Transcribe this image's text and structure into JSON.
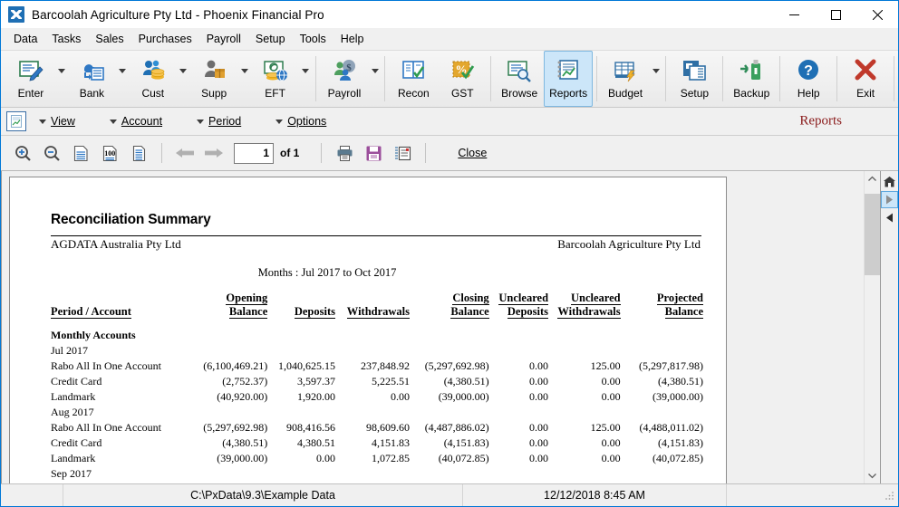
{
  "titlebar": {
    "title": "Barcoolah Agriculture Pty Ltd - Phoenix Financial Pro",
    "app_icon": "phoenix-app-icon",
    "minimize": "minimize-icon",
    "maximize": "maximize-icon",
    "close": "close-icon"
  },
  "menubar": {
    "items": [
      {
        "label": "Data"
      },
      {
        "label": "Tasks"
      },
      {
        "label": "Sales"
      },
      {
        "label": "Purchases"
      },
      {
        "label": "Payroll"
      },
      {
        "label": "Setup"
      },
      {
        "label": "Tools"
      },
      {
        "label": "Help"
      }
    ]
  },
  "ribbon": {
    "buttons": [
      {
        "label": "Enter",
        "icon": "enter-note-pencil-icon",
        "dropdown": true,
        "active": false
      },
      {
        "label": "Bank",
        "icon": "bank-cloud-icon",
        "dropdown": true,
        "active": false
      },
      {
        "label": "Cust",
        "icon": "customers-coins-icon",
        "dropdown": true,
        "active": false
      },
      {
        "label": "Supp",
        "icon": "supplier-box-icon",
        "dropdown": true,
        "active": false
      },
      {
        "label": "EFT",
        "icon": "eft-globe-coins-icon",
        "dropdown": true,
        "active": false
      },
      {
        "label": "Payroll",
        "icon": "payroll-dollar-icon",
        "dropdown": true,
        "active": false
      },
      {
        "label": "Recon",
        "icon": "recon-book-check-icon",
        "dropdown": false,
        "active": false
      },
      {
        "label": "GST",
        "icon": "gst-percent-check-icon",
        "dropdown": false,
        "active": false
      },
      {
        "label": "Browse",
        "icon": "browse-magnifier-icon",
        "dropdown": false,
        "active": false
      },
      {
        "label": "Reports",
        "icon": "reports-chart-icon",
        "dropdown": false,
        "active": true
      },
      {
        "label": "Budget",
        "icon": "budget-grid-bolt-icon",
        "dropdown": true,
        "active": false
      },
      {
        "label": "Setup",
        "icon": "setup-books-icon",
        "dropdown": false,
        "active": false
      },
      {
        "label": "Backup",
        "icon": "backup-usb-icon",
        "dropdown": false,
        "active": false
      },
      {
        "label": "Help",
        "icon": "help-question-icon",
        "dropdown": false,
        "active": false
      },
      {
        "label": "Exit",
        "icon": "exit-cross-icon",
        "dropdown": false,
        "active": false
      }
    ]
  },
  "viewbar": {
    "icon": "report-view-icon",
    "menus": [
      {
        "label": "View",
        "accel": "V"
      },
      {
        "label": "Account",
        "accel": "A"
      },
      {
        "label": "Period",
        "accel": "P"
      },
      {
        "label": "Options",
        "accel": "O"
      }
    ],
    "title": "Reports",
    "title_color": "#8a1a1a"
  },
  "report_toolbar": {
    "zoom_in": "zoom-in-icon",
    "zoom_out": "zoom-out-icon",
    "fit_width": "fit-width-icon",
    "zoom_100": "zoom-100-icon",
    "fit_page": "fit-page-icon",
    "prev_page": "prev-page-arrow-icon",
    "next_page": "next-page-arrow-icon",
    "page_value": "1",
    "page_of": "of 1",
    "print": "print-icon",
    "save": "save-floppy-icon",
    "export": "export-icon",
    "close_label": "Close",
    "close_accel": "C"
  },
  "report": {
    "title": "Reconciliation Summary",
    "subtitle_left": "AGDATA Australia Pty Ltd",
    "subtitle_right": "Barcoolah Agriculture Pty Ltd",
    "months": "Months : Jul 2017 to Oct 2017",
    "columns": [
      {
        "line1": "",
        "line2": "Period / Account",
        "align": "left"
      },
      {
        "line1": "Opening",
        "line2": "Balance",
        "align": "right"
      },
      {
        "line1": "",
        "line2": "Deposits",
        "align": "right"
      },
      {
        "line1": "",
        "line2": "Withdrawals",
        "align": "right"
      },
      {
        "line1": "Closing",
        "line2": "Balance",
        "align": "right"
      },
      {
        "line1": "Uncleared",
        "line2": "Deposits",
        "align": "right"
      },
      {
        "line1": "Uncleared",
        "line2": "Withdrawals",
        "align": "right"
      },
      {
        "line1": "Projected",
        "line2": "Balance",
        "align": "right"
      }
    ],
    "group_label": "Monthly Accounts",
    "periods": [
      {
        "label": "Jul 2017",
        "rows": [
          {
            "account": "Rabo All In One Account",
            "opening": "(6,100,469.21)",
            "deposits": "1,040,625.15",
            "withdrawals": "237,848.92",
            "closing": "(5,297,692.98)",
            "unc_deposits": "0.00",
            "unc_withdrawals": "125.00",
            "projected": "(5,297,817.98)"
          },
          {
            "account": "Credit Card",
            "opening": "(2,752.37)",
            "deposits": "3,597.37",
            "withdrawals": "5,225.51",
            "closing": "(4,380.51)",
            "unc_deposits": "0.00",
            "unc_withdrawals": "0.00",
            "projected": "(4,380.51)"
          },
          {
            "account": "Landmark",
            "opening": "(40,920.00)",
            "deposits": "1,920.00",
            "withdrawals": "0.00",
            "closing": "(39,000.00)",
            "unc_deposits": "0.00",
            "unc_withdrawals": "0.00",
            "projected": "(39,000.00)"
          }
        ]
      },
      {
        "label": "Aug 2017",
        "rows": [
          {
            "account": "Rabo All In One Account",
            "opening": "(5,297,692.98)",
            "deposits": "908,416.56",
            "withdrawals": "98,609.60",
            "closing": "(4,487,886.02)",
            "unc_deposits": "0.00",
            "unc_withdrawals": "125.00",
            "projected": "(4,488,011.02)"
          },
          {
            "account": "Credit Card",
            "opening": "(4,380.51)",
            "deposits": "4,380.51",
            "withdrawals": "4,151.83",
            "closing": "(4,151.83)",
            "unc_deposits": "0.00",
            "unc_withdrawals": "0.00",
            "projected": "(4,151.83)"
          },
          {
            "account": "Landmark",
            "opening": "(39,000.00)",
            "deposits": "0.00",
            "withdrawals": "1,072.85",
            "closing": "(40,072.85)",
            "unc_deposits": "0.00",
            "unc_withdrawals": "0.00",
            "projected": "(40,072.85)"
          }
        ]
      },
      {
        "label": "Sep 2017",
        "rows": []
      }
    ]
  },
  "right_rail": {
    "home": "home-icon",
    "forward": "play-right-icon",
    "back": "play-left-icon"
  },
  "statusbar": {
    "data_path": "C:\\PxData\\9.3\\Example Data",
    "datetime": "12/12/2018  8:45 AM",
    "grip": "resize-grip-icon"
  }
}
